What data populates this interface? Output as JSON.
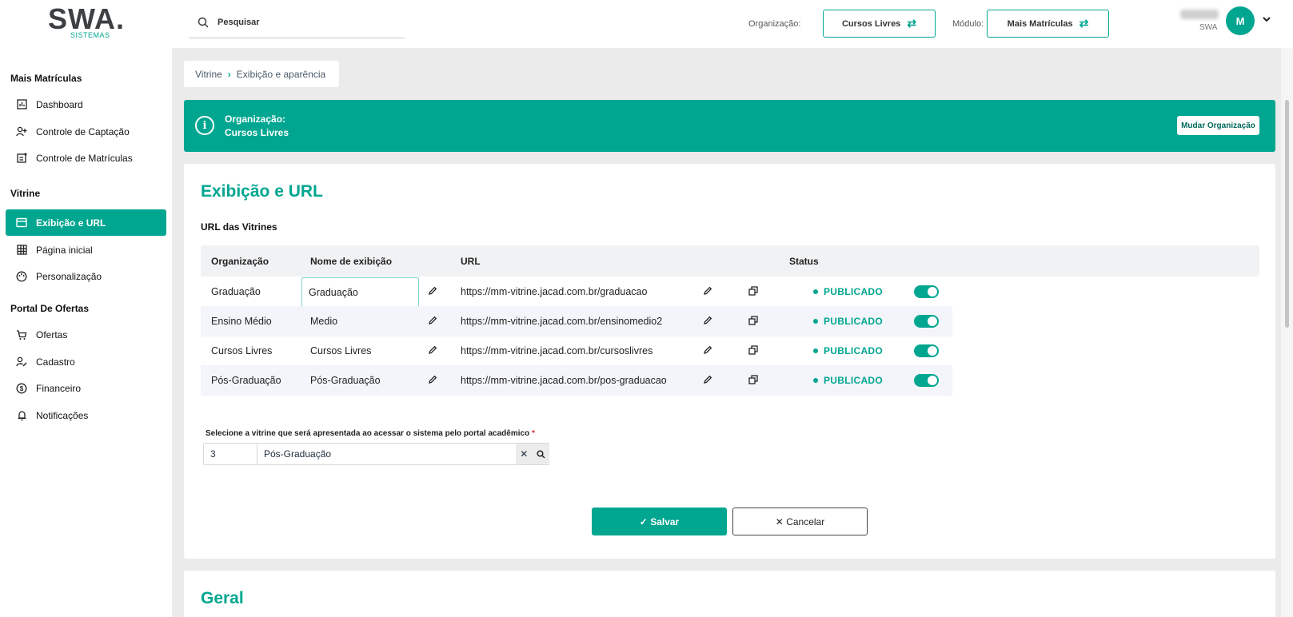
{
  "logo": {
    "main": "SWA.",
    "sub": "SISTEMAS"
  },
  "search": {
    "placeholder": "Pesquisar"
  },
  "header": {
    "org_label": "Organização:",
    "org_value": "Cursos Livres",
    "module_label": "Módulo:",
    "module_value": "Mais Matrículas",
    "user_org": "SWA",
    "avatar_initial": "M"
  },
  "sidebar": {
    "sections": [
      {
        "title": "Mais Matrículas",
        "items": [
          {
            "label": "Dashboard",
            "icon": "chart-icon"
          },
          {
            "label": "Controle de Captação",
            "icon": "person-add-icon"
          },
          {
            "label": "Controle de Matrículas",
            "icon": "enrollment-icon"
          }
        ]
      },
      {
        "title": "Vitrine",
        "items": [
          {
            "label": "Exibição e URL",
            "icon": "storefront-icon",
            "active": true
          },
          {
            "label": "Página inicial",
            "icon": "grid-icon"
          },
          {
            "label": "Personalização",
            "icon": "palette-icon"
          }
        ]
      },
      {
        "title": "Portal De Ofertas",
        "items": [
          {
            "label": "Ofertas",
            "icon": "cart-icon"
          },
          {
            "label": "Cadastro",
            "icon": "person-edit-icon"
          },
          {
            "label": "Financeiro",
            "icon": "dollar-icon"
          },
          {
            "label": "Notificações",
            "icon": "bell-icon"
          }
        ]
      }
    ]
  },
  "breadcrumb": {
    "root": "Vitrine",
    "current": "Exibição e aparência"
  },
  "banner": {
    "line1": "Organização:",
    "line2": "Cursos Livres",
    "button": "Mudar Organização"
  },
  "main": {
    "title": "Exibição e URL",
    "subtitle": "URL das Vitrines",
    "columns": [
      "Organização",
      "Nome de exibição",
      "URL",
      "Status"
    ],
    "rows": [
      {
        "org": "Graduação",
        "display_name": "Graduação",
        "url": "https://mm-vitrine.jacad.com.br/graduacao",
        "status": "PUBLICADO",
        "enabled": true,
        "editing": true
      },
      {
        "org": "Ensino Médio",
        "display_name": "Medio",
        "url": "https://mm-vitrine.jacad.com.br/ensinomedio2",
        "status": "PUBLICADO",
        "enabled": true
      },
      {
        "org": "Cursos Livres",
        "display_name": "Cursos Livres",
        "url": "https://mm-vitrine.jacad.com.br/cursoslivres",
        "status": "PUBLICADO",
        "enabled": true
      },
      {
        "org": "Pós-Graduação",
        "display_name": "Pós-Graduação",
        "url": "https://mm-vitrine.jacad.com.br/pos-graduacao",
        "status": "PUBLICADO",
        "enabled": true
      }
    ],
    "select_label": "Selecione a vitrine que será apresentada ao acessar o sistema pelo portal acadêmico",
    "select_required": "*",
    "select_code": "3",
    "select_value": "Pós-Graduação",
    "save_label": "Salvar",
    "cancel_label": "Cancelar"
  },
  "section2": {
    "title": "Geral"
  },
  "colors": {
    "accent": "#00a690",
    "background": "#ebebeb"
  }
}
